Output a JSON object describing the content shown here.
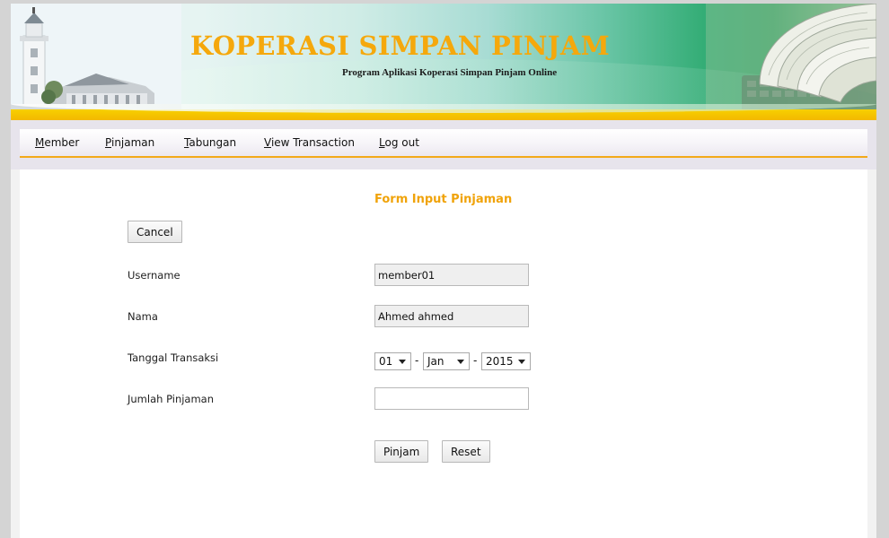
{
  "header": {
    "title": "KOPERASI SIMPAN PINJAM",
    "subtitle": "Program Aplikasi Koperasi Simpan Pinjam Online"
  },
  "nav": {
    "items": [
      {
        "first": "M",
        "rest": "ember"
      },
      {
        "first": "P",
        "rest": "injaman"
      },
      {
        "first": "T",
        "rest": "abungan"
      },
      {
        "first": "V",
        "rest": "iew Transaction"
      },
      {
        "first": "L",
        "rest": "og out"
      }
    ]
  },
  "form": {
    "title": "Form Input Pinjaman",
    "cancel_label": "Cancel",
    "username": {
      "label": "Username",
      "value": "member01"
    },
    "nama": {
      "label": "Nama",
      "value": "Ahmed ahmed"
    },
    "tanggal": {
      "label": "Tanggal Transaksi",
      "day": "01",
      "month": "Jan",
      "year": "2015",
      "separator": "-"
    },
    "jumlah": {
      "label": "Jumlah Pinjaman",
      "value": ""
    },
    "submit_label": "Pinjam",
    "reset_label": "Reset"
  },
  "colors": {
    "accent": "#f0a30a",
    "gold_band": "#f5c400"
  }
}
